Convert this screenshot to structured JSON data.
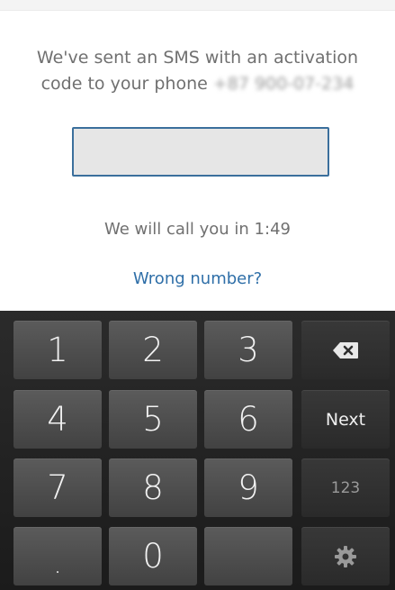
{
  "verification": {
    "message_line1": "We've sent an SMS with an activation",
    "message_line2": "code to your phone",
    "phone_number_blurred": "+87 900-07-234",
    "code_input_value": "",
    "timer_text": "We will call you in 1:49",
    "wrong_number_link": "Wrong number?"
  },
  "keyboard": {
    "rows": [
      [
        "1",
        "2",
        "3",
        "backspace"
      ],
      [
        "4",
        "5",
        "6",
        "Next"
      ],
      [
        "7",
        "8",
        "9",
        "123"
      ],
      [
        ".",
        "0",
        "",
        "settings"
      ]
    ],
    "keys": {
      "k1": "1",
      "k2": "2",
      "k3": "3",
      "k4": "4",
      "k5": "5",
      "k6": "6",
      "k7": "7",
      "k8": "8",
      "k9": "9",
      "k0": "0",
      "dot": ".",
      "next": "Next",
      "mode_123": "123"
    },
    "icons": {
      "backspace": "backspace-icon",
      "settings": "gear-icon"
    }
  },
  "colors": {
    "link": "#2f6fa8",
    "input_border": "#3b6f9c",
    "text_gray": "#707070"
  }
}
